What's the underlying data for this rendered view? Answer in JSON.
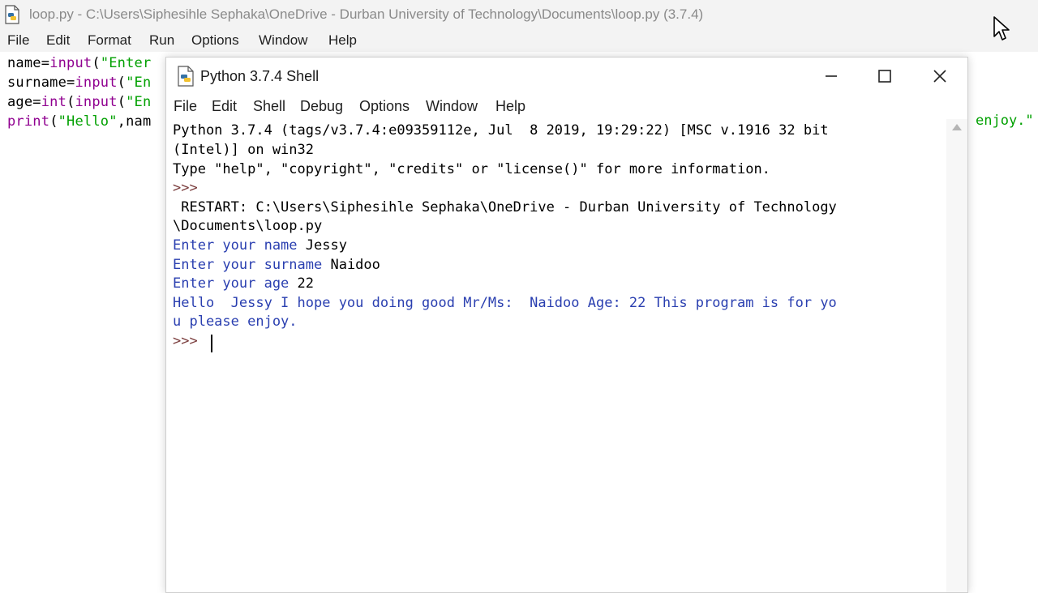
{
  "editor": {
    "title": "loop.py - C:\\Users\\Siphesihle Sephaka\\OneDrive - Durban University of Technology\\Documents\\loop.py (3.7.4)",
    "menu": [
      "File",
      "Edit",
      "Format",
      "Run",
      "Options",
      "Window",
      "Help"
    ],
    "code_lines": [
      {
        "pre": "name=",
        "kw": "input",
        "mid": "(",
        "str": "\"Enter"
      },
      {
        "pre": "surname=",
        "kw": "input",
        "mid": "(",
        "str": "\"En"
      },
      {
        "pre": "age=",
        "kw": "int",
        "mid": "(",
        "kw2": "input",
        "mid2": "(",
        "str": "\"En"
      },
      {
        "pre": "",
        "kw": "print",
        "mid": "(",
        "str": "\"Hello\"",
        "tail": ",nam"
      }
    ],
    "overflow_text": "enjoy.\""
  },
  "shell": {
    "title": "Python 3.7.4 Shell",
    "controls": {
      "minimize": "—",
      "maximize": "☐",
      "close": "✕"
    },
    "menu": [
      "File",
      "Edit",
      "Shell",
      "Debug",
      "Options",
      "Window",
      "Help"
    ],
    "lines": [
      "Python 3.7.4 (tags/v3.7.4:e09359112e, Jul  8 2019, 19:29:22) [MSC v.1916 32 bit",
      "(Intel)] on win32",
      "Type \"help\", \"copyright\", \"credits\" or \"license()\" for more information.",
      ">>> ",
      " RESTART: C:\\Users\\Siphesihle Sephaka\\OneDrive - Durban University of Technology",
      "\\Documents\\loop.py",
      "Enter your name ",
      "Enter your surname ",
      "Enter your age ",
      "Hello  Jessy I hope you doing good Mr/Ms:  Naidoo Age: 22 This program is for yo",
      "u please enjoy.",
      ">>> "
    ],
    "inputs": {
      "name": "Jessy",
      "surname": "Naidoo",
      "age": "22"
    }
  },
  "colors": {
    "output_blue": "#2a3fb0",
    "keyword_purple": "#900090",
    "string_green": "#00a000",
    "prompt_brown": "#7a3c3c"
  },
  "icons": [
    "python-file-icon",
    "mouse-cursor-icon",
    "minimize-icon",
    "maximize-icon",
    "close-icon",
    "scroll-up-icon"
  ]
}
